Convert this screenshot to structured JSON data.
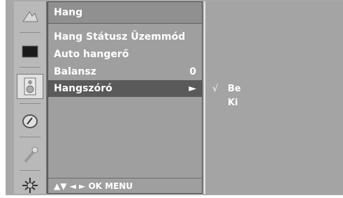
{
  "sidebar": {
    "icons": [
      {
        "name": "picture-icon"
      },
      {
        "name": "tv-screen-icon"
      },
      {
        "name": "speaker-icon"
      },
      {
        "name": "clock-icon"
      },
      {
        "name": "key-icon"
      },
      {
        "name": "input-icon"
      }
    ]
  },
  "menu": {
    "title": "Hang",
    "items": [
      {
        "label": "Hang Státusz Üzemmód",
        "value": ""
      },
      {
        "label": "Auto hangerő",
        "value": ""
      },
      {
        "label": "Balansz",
        "value": "0"
      },
      {
        "label": "Hangszóró",
        "value": "►"
      }
    ],
    "nav_hint": "▲▼  ◄ ►  OK  MENU"
  },
  "submenu": {
    "check_mark": "√",
    "options": [
      {
        "label": "Be",
        "checked": true
      },
      {
        "label": "Ki",
        "checked": false
      }
    ]
  }
}
